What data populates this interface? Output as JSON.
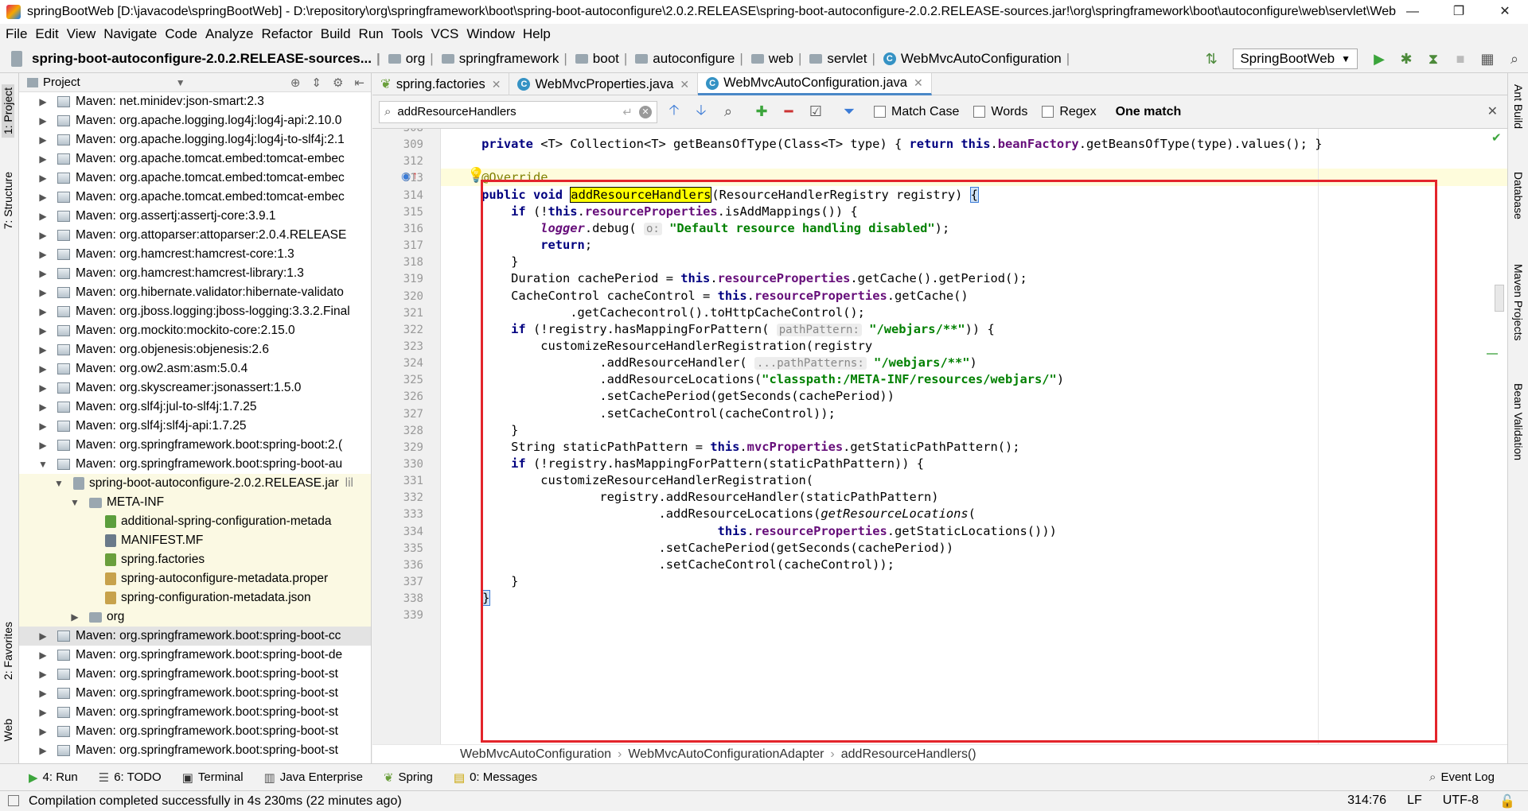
{
  "titlebar": {
    "title": "springBootWeb [D:\\javacode\\springBootWeb] - D:\\repository\\org\\springframework\\boot\\spring-boot-autoconfigure\\2.0.2.RELEASE\\spring-boot-autoconfigure-2.0.2.RELEASE-sources.jar!\\org\\springframework\\boot\\autoconfigure\\web\\servlet\\WebMvcAutoC...",
    "minimize": "—",
    "maximize": "❐",
    "close": "✕"
  },
  "menu": [
    "File",
    "Edit",
    "View",
    "Navigate",
    "Code",
    "Analyze",
    "Refactor",
    "Build",
    "Run",
    "Tools",
    "VCS",
    "Window",
    "Help"
  ],
  "navbar": {
    "crumbs": [
      "spring-boot-autoconfigure-2.0.2.RELEASE-sources...",
      "org",
      "springframework",
      "boot",
      "autoconfigure",
      "web",
      "servlet",
      "WebMvcAutoConfiguration"
    ],
    "run_config": "SpringBootWeb"
  },
  "left_tool_tabs": [
    "1: Project",
    "7: Structure",
    "2: Favorites",
    "Web"
  ],
  "right_tool_tabs": [
    "Ant Build",
    "Database",
    "Maven Projects",
    "Bean Validation"
  ],
  "project": {
    "title": "Project",
    "items": [
      "Maven: net.minidev:json-smart:2.3",
      "Maven: org.apache.logging.log4j:log4j-api:2.10.0",
      "Maven: org.apache.logging.log4j:log4j-to-slf4j:2.1",
      "Maven: org.apache.tomcat.embed:tomcat-embec",
      "Maven: org.apache.tomcat.embed:tomcat-embec",
      "Maven: org.apache.tomcat.embed:tomcat-embec",
      "Maven: org.assertj:assertj-core:3.9.1",
      "Maven: org.attoparser:attoparser:2.0.4.RELEASE",
      "Maven: org.hamcrest:hamcrest-core:1.3",
      "Maven: org.hamcrest:hamcrest-library:1.3",
      "Maven: org.hibernate.validator:hibernate-validato",
      "Maven: org.jboss.logging:jboss-logging:3.3.2.Final",
      "Maven: org.mockito:mockito-core:2.15.0",
      "Maven: org.objenesis:objenesis:2.6",
      "Maven: org.ow2.asm:asm:5.0.4",
      "Maven: org.skyscreamer:jsonassert:1.5.0",
      "Maven: org.slf4j:jul-to-slf4j:1.7.25",
      "Maven: org.slf4j:slf4j-api:1.7.25",
      "Maven: org.springframework.boot:spring-boot:2.(",
      "Maven: org.springframework.boot:spring-boot-au",
      "spring-boot-autoconfigure-2.0.2.RELEASE.jar",
      "META-INF",
      "additional-spring-configuration-metada",
      "MANIFEST.MF",
      "spring.factories",
      "spring-autoconfigure-metadata.proper",
      "spring-configuration-metadata.json",
      "org",
      "Maven: org.springframework.boot:spring-boot-cc",
      "Maven: org.springframework.boot:spring-boot-de",
      "Maven: org.springframework.boot:spring-boot-st",
      "Maven: org.springframework.boot:spring-boot-st",
      "Maven: org.springframework.boot:spring-boot-st",
      "Maven: org.springframework.boot:spring-boot-st",
      "Maven: org.springframework.boot:spring-boot-st"
    ],
    "jar_suffix": "lil"
  },
  "tabs": [
    "spring.factories",
    "WebMvcProperties.java",
    "WebMvcAutoConfiguration.java"
  ],
  "search": {
    "query": "addResourceHandlers",
    "match_case": "Match Case",
    "words": "Words",
    "regex": "Regex",
    "result": "One match"
  },
  "code": {
    "line_numbers": [
      "308",
      "309",
      "312",
      "313",
      "314",
      "315",
      "316",
      "317",
      "318",
      "319",
      "320",
      "321",
      "322",
      "323",
      "324",
      "325",
      "326",
      "327",
      "328",
      "329",
      "330",
      "331",
      "332",
      "333",
      "334",
      "335",
      "336",
      "337",
      "338",
      "339"
    ],
    "hint_o": "o:",
    "hint_pathpattern": "pathPattern:",
    "hint_pathpatterns": "...pathPatterns:"
  },
  "code_breadcrumbs": [
    "WebMvcAutoConfiguration",
    "WebMvcAutoConfigurationAdapter",
    "addResourceHandlers()"
  ],
  "tool_windows": [
    "4: Run",
    "6: TODO",
    "Terminal",
    "Java Enterprise",
    "Spring",
    "0: Messages"
  ],
  "event_log": "Event Log",
  "status": {
    "message": "Compilation completed successfully in 4s 230ms (22 minutes ago)",
    "position": "314:76",
    "line_sep": "LF",
    "encoding": "UTF-8"
  },
  "colors": {
    "accent": "#4a88c7",
    "highlight_box": "#e3242b",
    "match": "#ffff00"
  }
}
